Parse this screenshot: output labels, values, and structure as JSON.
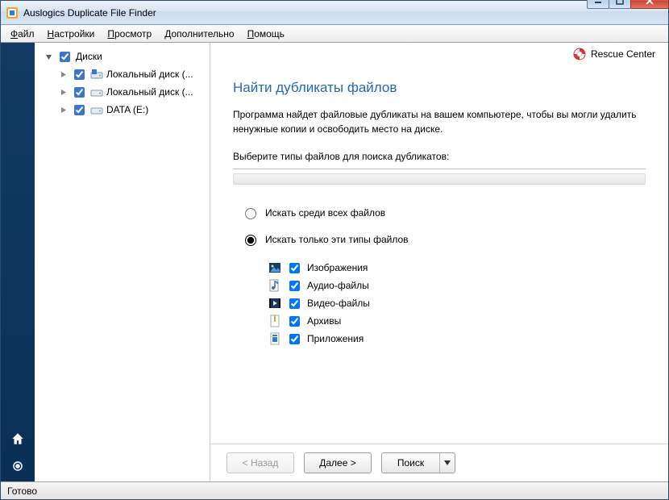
{
  "window": {
    "title": "Auslogics Duplicate File Finder"
  },
  "menu": {
    "items": [
      {
        "label": "Файл",
        "ul": 0
      },
      {
        "label": "Настройки",
        "ul": 0
      },
      {
        "label": "Просмотр",
        "ul": 0
      },
      {
        "label": "Дополнительно",
        "ul": 0
      },
      {
        "label": "Помощь",
        "ul": 0
      }
    ]
  },
  "tree": {
    "root_label": "Диски",
    "items": [
      {
        "label": "Локальный диск (...",
        "checked": true,
        "icon": "drive-sys"
      },
      {
        "label": "Локальный диск (...",
        "checked": true,
        "icon": "drive"
      },
      {
        "label": "DATA (E:)",
        "checked": true,
        "icon": "drive"
      }
    ]
  },
  "rescue": {
    "label": "Rescue Center"
  },
  "main": {
    "headline": "Найти дубликаты файлов",
    "paragraph": "Программа найдет файловые дубликаты на вашем компьютере, чтобы вы могли удалить ненужные копии и освободить место на диске.",
    "subhead": "Выберите типы файлов для поиска дубликатов:",
    "radio_all": "Искать среди всех файлов",
    "radio_types": "Искать только эти типы файлов",
    "filetypes": [
      {
        "label": "Изображения",
        "checked": true,
        "icon": "image"
      },
      {
        "label": "Аудио-файлы",
        "checked": true,
        "icon": "audio"
      },
      {
        "label": "Видео-файлы",
        "checked": true,
        "icon": "video"
      },
      {
        "label": "Архивы",
        "checked": true,
        "icon": "archive"
      },
      {
        "label": "Приложения",
        "checked": true,
        "icon": "app"
      }
    ]
  },
  "buttons": {
    "back": "< Назад",
    "next": "Далее >",
    "search": "Поиск"
  },
  "status": {
    "text": "Готово"
  }
}
